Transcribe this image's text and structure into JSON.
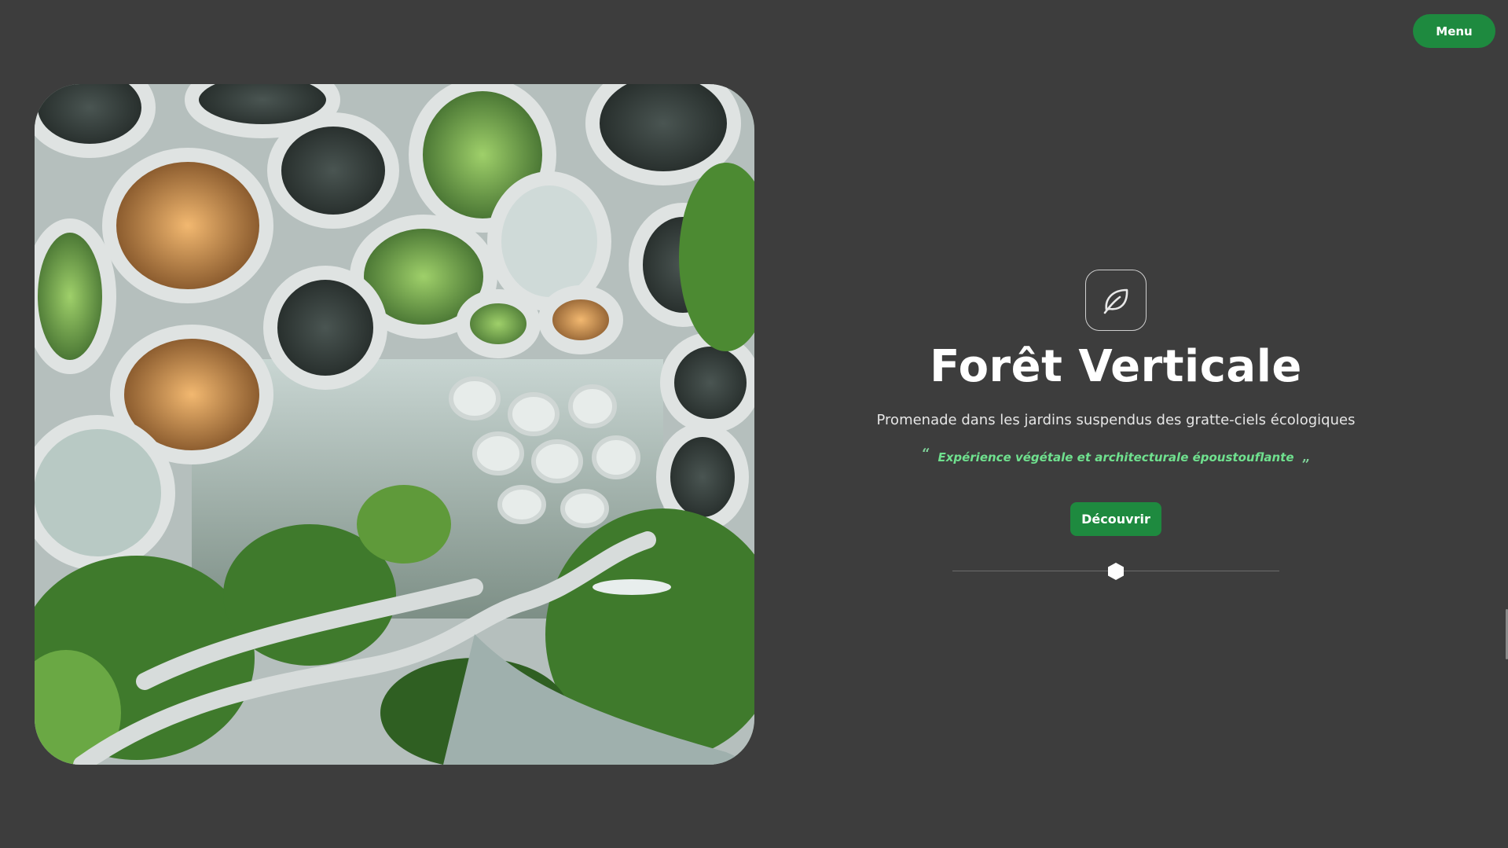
{
  "header": {
    "menu_label": "Menu"
  },
  "hero": {
    "image_alt": "Forêt Verticale",
    "title": "Forêt Verticale",
    "subtitle": "Promenade dans les jardins suspendus des gratte-ciels écologiques",
    "quote_open": "“",
    "quote": "Expérience végétale et architecturale époustouflante",
    "quote_close": "”",
    "cta_label": "Découvrir",
    "icon": "leaf-icon"
  },
  "slider": {
    "value": 0.5
  },
  "colors": {
    "background": "#3d3d3d",
    "accent": "#1e8a3f",
    "quote": "#6fe08e"
  }
}
